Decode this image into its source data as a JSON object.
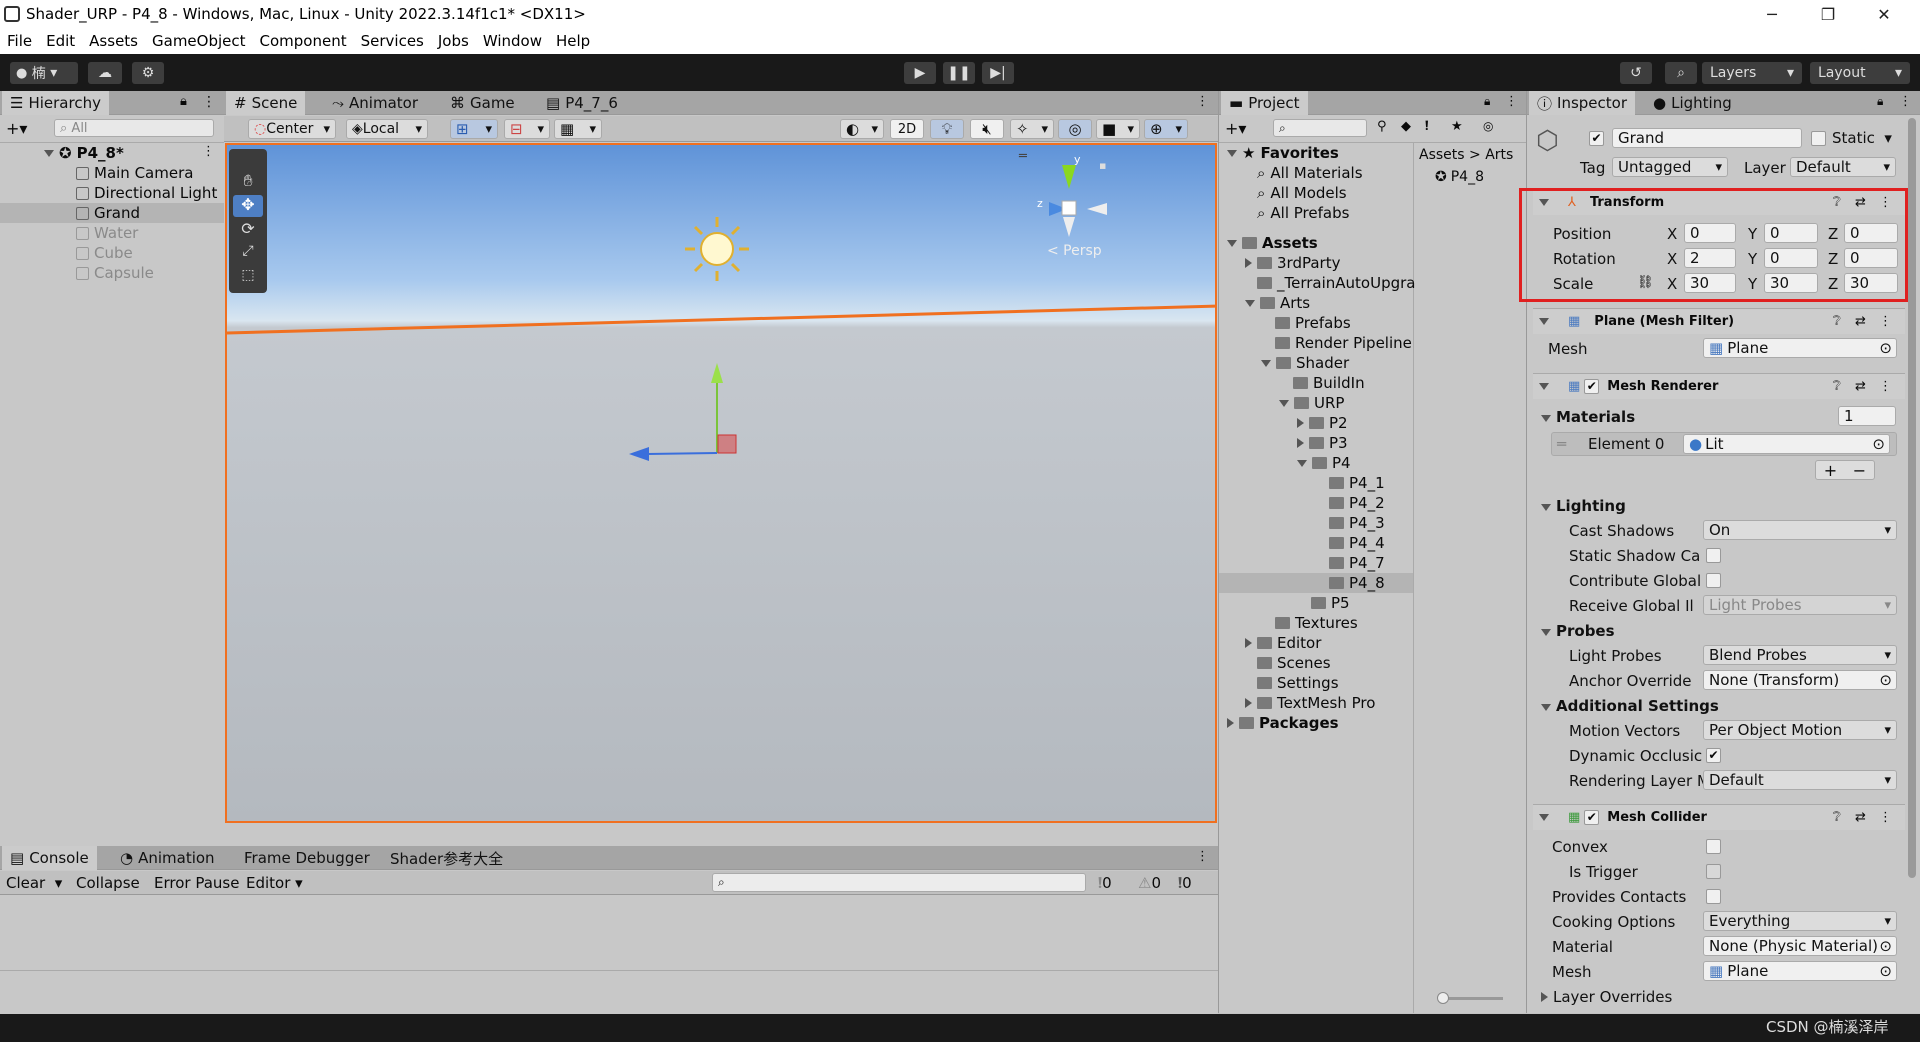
{
  "window": {
    "title": "Shader_URP - P4_8 - Windows, Mac, Linux - Unity 2022.3.14f1c1* <DX11>",
    "min": "─",
    "max": "❐",
    "close": "✕"
  },
  "menu": [
    "File",
    "Edit",
    "Assets",
    "GameObject",
    "Component",
    "Services",
    "Jobs",
    "Window",
    "Help"
  ],
  "toolbar": {
    "account_label": "楠",
    "layers_label": "Layers",
    "layout_label": "Layout"
  },
  "hierarchy": {
    "tab": "Hierarchy",
    "search_placeholder": "All",
    "scene": "P4_8*",
    "items": [
      {
        "label": "Main Camera"
      },
      {
        "label": "Directional Light"
      },
      {
        "label": "Grand"
      },
      {
        "label": "Water"
      },
      {
        "label": "Cube"
      },
      {
        "label": "Capsule"
      }
    ]
  },
  "scene_view": {
    "tabs": [
      "Scene",
      "Animator",
      "Game",
      "P4_7_6"
    ],
    "pivot": "Center",
    "space": "Local",
    "mode_2d": "2D",
    "persp": "< Persp",
    "gizmo_axes": {
      "y": "y",
      "z": "z"
    }
  },
  "console": {
    "tabs": [
      "Console",
      "Animation",
      "Frame Debugger",
      "Shader参考大全"
    ],
    "buttons": [
      "Clear",
      "Collapse",
      "Error Pause",
      "Editor"
    ],
    "counts": [
      "0",
      "0",
      "0"
    ]
  },
  "project": {
    "tab": "Project",
    "breadcrumb": [
      "Assets",
      "Arts"
    ],
    "selected_asset": "P4_8",
    "favorites": {
      "label": "Favorites",
      "items": [
        "All Materials",
        "All Models",
        "All Prefabs"
      ]
    },
    "tree": [
      {
        "label": "Assets",
        "bold": true
      },
      {
        "label": "3rdParty"
      },
      {
        "label": "_TerrainAutoUpgra"
      },
      {
        "label": "Arts"
      },
      {
        "label": "Prefabs"
      },
      {
        "label": "Render Pipeline"
      },
      {
        "label": "Shader"
      },
      {
        "label": "BuildIn"
      },
      {
        "label": "URP"
      },
      {
        "label": "P2"
      },
      {
        "label": "P3"
      },
      {
        "label": "P4"
      },
      {
        "label": "P4_1"
      },
      {
        "label": "P4_2"
      },
      {
        "label": "P4_3"
      },
      {
        "label": "P4_4"
      },
      {
        "label": "P4_7"
      },
      {
        "label": "P4_8"
      },
      {
        "label": "P5"
      },
      {
        "label": "Textures"
      },
      {
        "label": "Editor"
      },
      {
        "label": "Scenes"
      },
      {
        "label": "Settings"
      },
      {
        "label": "TextMesh Pro"
      },
      {
        "label": "Packages",
        "bold": true
      }
    ]
  },
  "inspector": {
    "tabs": [
      "Inspector",
      "Lighting"
    ],
    "object_name": "Grand",
    "static_label": "Static",
    "tag_label": "Tag",
    "tag_value": "Untagged",
    "layer_label": "Layer",
    "layer_value": "Default",
    "transform": {
      "title": "Transform",
      "rows": [
        {
          "label": "Position",
          "x": "0",
          "y": "0",
          "z": "0"
        },
        {
          "label": "Rotation",
          "x": "2",
          "y": "0",
          "z": "0"
        },
        {
          "label": "Scale",
          "x": "30",
          "y": "30",
          "z": "30"
        }
      ],
      "axes": [
        "X",
        "Y",
        "Z"
      ]
    },
    "mesh_filter": {
      "title": "Plane (Mesh Filter)",
      "mesh_label": "Mesh",
      "mesh_value": "Plane"
    },
    "mesh_renderer": {
      "title": "Mesh Renderer",
      "materials_label": "Materials",
      "materials_count": "1",
      "element_label": "Element 0",
      "element_value": "Lit",
      "lighting_label": "Lighting",
      "cast_shadows_label": "Cast Shadows",
      "cast_shadows_value": "On",
      "static_shadow_label": "Static Shadow Ca",
      "contribute_gi_label": "Contribute Global",
      "receive_gi_label": "Receive Global Illu",
      "receive_gi_value": "Light Probes",
      "probes_label": "Probes",
      "light_probes_label": "Light Probes",
      "light_probes_value": "Blend Probes",
      "anchor_label": "Anchor Override",
      "anchor_value": "None (Transform)",
      "additional_label": "Additional Settings",
      "motion_label": "Motion Vectors",
      "motion_value": "Per Object Motion",
      "dynamic_occ_label": "Dynamic Occlusic",
      "rendering_layer_label": "Rendering Layer M",
      "rendering_layer_value": "Default"
    },
    "mesh_collider": {
      "title": "Mesh Collider",
      "convex_label": "Convex",
      "trigger_label": "Is Trigger",
      "contacts_label": "Provides Contacts",
      "cooking_label": "Cooking Options",
      "cooking_value": "Everything",
      "material_label": "Material",
      "material_value": "None (Physic Material)",
      "mesh_label": "Mesh",
      "mesh_value": "Plane",
      "layer_overrides_label": "Layer Overrides"
    }
  },
  "watermark": "CSDN @楠溪泽岸",
  "colors": {
    "highlight_red": "#e02020",
    "selection_orange": "#f07020",
    "toolbar": "#191919"
  }
}
